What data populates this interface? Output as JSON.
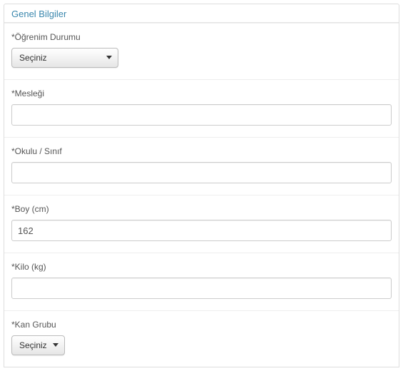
{
  "section_title": "Genel Bilgiler",
  "fields": {
    "education": {
      "label": "Öğrenim Durumu",
      "selected": "Seçiniz"
    },
    "profession": {
      "label": "Mesleği",
      "value": ""
    },
    "school_class": {
      "label": "Okulu / Sınıf",
      "value": ""
    },
    "height": {
      "label": "Boy (cm)",
      "value": "162"
    },
    "weight": {
      "label": "Kilo (kg)",
      "value": ""
    },
    "blood_type": {
      "label": "Kan Grubu",
      "selected": "Seçiniz"
    }
  }
}
